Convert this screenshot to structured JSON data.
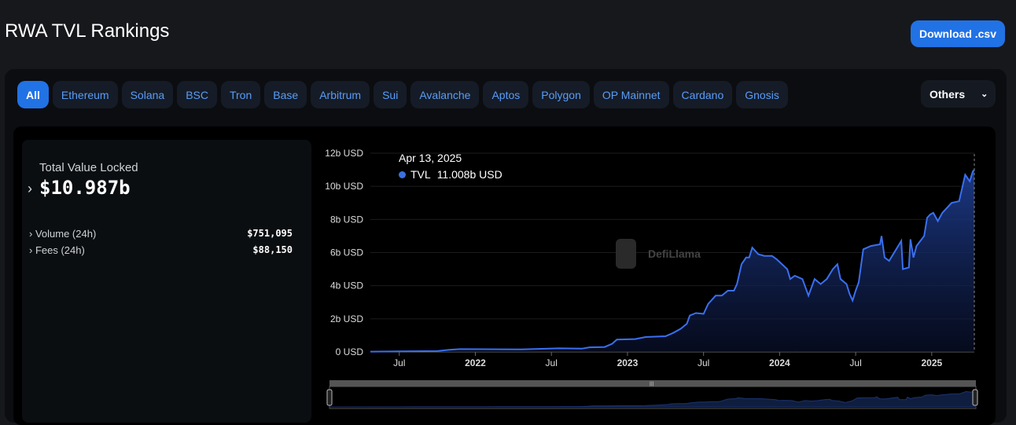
{
  "header": {
    "title": "RWA TVL Rankings",
    "download_label": "Download .csv"
  },
  "chains": [
    "All",
    "Ethereum",
    "Solana",
    "BSC",
    "Tron",
    "Base",
    "Arbitrum",
    "Sui",
    "Avalanche",
    "Aptos",
    "Polygon",
    "OP Mainnet",
    "Cardano",
    "Gnosis"
  ],
  "others_label": "Others",
  "summary": {
    "tvl_label": "Total Value Locked",
    "tvl_value": "$10.987b",
    "volume_label": "Volume (24h)",
    "volume_value": "$751,095",
    "fees_label": "Fees (24h)",
    "fees_value": "$88,150"
  },
  "tooltip": {
    "date": "Apr 13, 2025",
    "series": "TVL",
    "value": "11.008b USD"
  },
  "watermark": "DefiLlama",
  "colors": {
    "line": "#3a6ff0",
    "accent": "#2172e5"
  },
  "chart_data": {
    "type": "area",
    "title": "",
    "xlabel": "",
    "ylabel": "",
    "ylim": [
      0,
      12
    ],
    "y_unit": "b USD",
    "y_ticks": [
      "0 USD",
      "2b USD",
      "4b USD",
      "6b USD",
      "8b USD",
      "10b USD",
      "12b USD"
    ],
    "x_ticks": [
      {
        "label": "Jul",
        "x": 2021.5,
        "bold": false
      },
      {
        "label": "2022",
        "x": 2022.0,
        "bold": true
      },
      {
        "label": "Jul",
        "x": 2022.5,
        "bold": false
      },
      {
        "label": "2023",
        "x": 2023.0,
        "bold": true
      },
      {
        "label": "Jul",
        "x": 2023.5,
        "bold": false
      },
      {
        "label": "2024",
        "x": 2024.0,
        "bold": true
      },
      {
        "label": "Jul",
        "x": 2024.5,
        "bold": false
      },
      {
        "label": "2025",
        "x": 2025.0,
        "bold": true
      }
    ],
    "xlim": [
      2021.31,
      2025.28
    ],
    "series": [
      {
        "name": "TVL",
        "points": [
          [
            2021.31,
            0.02
          ],
          [
            2021.75,
            0.05
          ],
          [
            2021.83,
            0.13
          ],
          [
            2021.9,
            0.17
          ],
          [
            2022.3,
            0.15
          ],
          [
            2022.55,
            0.22
          ],
          [
            2022.7,
            0.2
          ],
          [
            2022.75,
            0.28
          ],
          [
            2022.85,
            0.3
          ],
          [
            2022.9,
            0.5
          ],
          [
            2022.93,
            0.75
          ],
          [
            2023.05,
            0.78
          ],
          [
            2023.12,
            0.9
          ],
          [
            2023.25,
            0.95
          ],
          [
            2023.3,
            1.15
          ],
          [
            2023.35,
            1.4
          ],
          [
            2023.39,
            1.7
          ],
          [
            2023.41,
            2.2
          ],
          [
            2023.45,
            2.35
          ],
          [
            2023.5,
            2.3
          ],
          [
            2023.53,
            2.9
          ],
          [
            2023.58,
            3.4
          ],
          [
            2023.62,
            3.4
          ],
          [
            2023.66,
            3.7
          ],
          [
            2023.7,
            3.7
          ],
          [
            2023.72,
            4.1
          ],
          [
            2023.75,
            5.3
          ],
          [
            2023.78,
            5.7
          ],
          [
            2023.8,
            5.7
          ],
          [
            2023.82,
            6.3
          ],
          [
            2023.86,
            5.9
          ],
          [
            2023.9,
            5.8
          ],
          [
            2023.95,
            5.8
          ],
          [
            2023.98,
            5.6
          ],
          [
            2024.05,
            5.0
          ],
          [
            2024.07,
            4.4
          ],
          [
            2024.1,
            4.6
          ],
          [
            2024.15,
            4.4
          ],
          [
            2024.19,
            3.4
          ],
          [
            2024.23,
            4.4
          ],
          [
            2024.27,
            4.1
          ],
          [
            2024.31,
            4.4
          ],
          [
            2024.35,
            5.0
          ],
          [
            2024.38,
            5.3
          ],
          [
            2024.4,
            4.4
          ],
          [
            2024.44,
            4.1
          ],
          [
            2024.46,
            3.5
          ],
          [
            2024.48,
            3.1
          ],
          [
            2024.5,
            3.7
          ],
          [
            2024.52,
            4.2
          ],
          [
            2024.55,
            6.2
          ],
          [
            2024.6,
            6.4
          ],
          [
            2024.66,
            6.5
          ],
          [
            2024.67,
            7.0
          ],
          [
            2024.69,
            5.7
          ],
          [
            2024.72,
            5.5
          ],
          [
            2024.8,
            6.7
          ],
          [
            2024.81,
            5.0
          ],
          [
            2024.85,
            5.1
          ],
          [
            2024.86,
            6.8
          ],
          [
            2024.88,
            5.7
          ],
          [
            2024.9,
            6.4
          ],
          [
            2024.95,
            7.0
          ],
          [
            2024.97,
            8.1
          ],
          [
            2024.99,
            8.3
          ],
          [
            2025.01,
            8.4
          ],
          [
            2025.04,
            7.9
          ],
          [
            2025.07,
            8.4
          ],
          [
            2025.13,
            9.0
          ],
          [
            2025.18,
            9.1
          ],
          [
            2025.2,
            9.9
          ],
          [
            2025.22,
            10.7
          ],
          [
            2025.25,
            10.3
          ],
          [
            2025.27,
            10.9
          ],
          [
            2025.28,
            10.99
          ]
        ]
      }
    ]
  }
}
